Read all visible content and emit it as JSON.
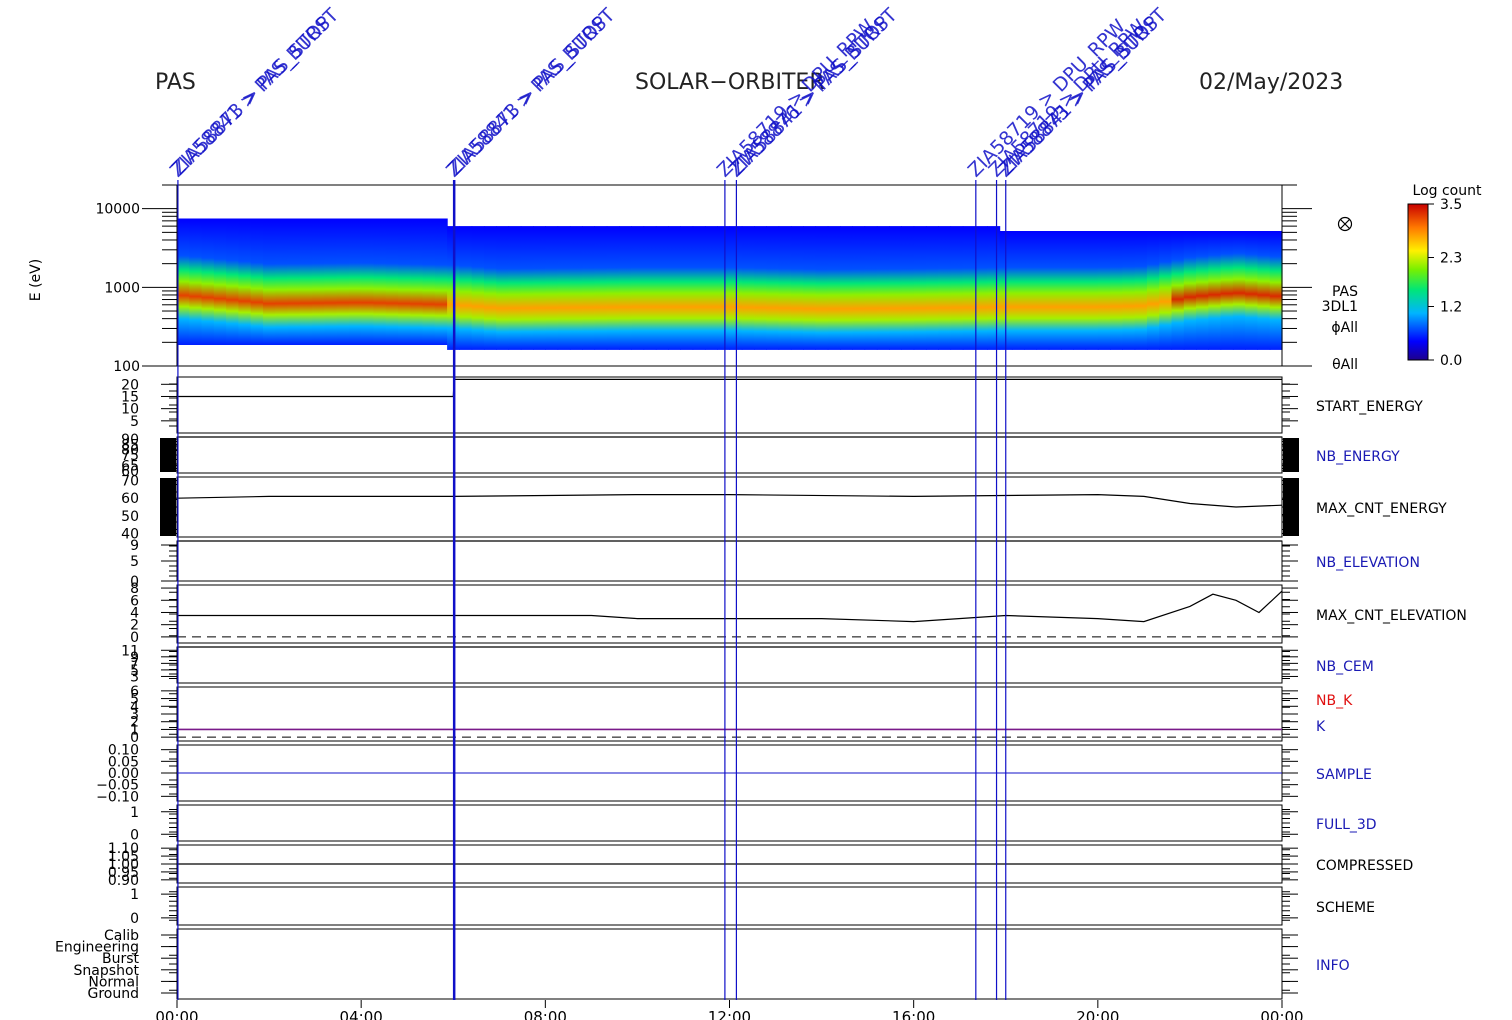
{
  "header": {
    "instrument": "PAS",
    "mission": "SOLAR−ORBITER",
    "date": "02/May/2023"
  },
  "colors": {
    "event_line": "#1010c8",
    "blue_label": "#1a1ab4",
    "red_label": "#e01010",
    "k_line": "#7a1a8a",
    "axes": "#000000"
  },
  "events": [
    {
      "t": 0.02,
      "labels": [
        "ZIA58841 > PAS_BURST",
        "ZIA58873 > PAS_STOP"
      ]
    },
    {
      "t": 6.02,
      "labels": [
        "ZIA58841 > PAS_BURST",
        "ZIA58873 > PAS_STOP"
      ]
    },
    {
      "t": 11.9,
      "labels": [
        "ZIA58719 > DPU_RPW"
      ]
    },
    {
      "t": 12.15,
      "labels": [
        "ZIA58876 > PAS_BURST",
        "ZIA58841 > PAS_STOP"
      ]
    },
    {
      "t": 17.35,
      "labels": [
        "ZIA58719 > DPU_RPW"
      ]
    },
    {
      "t": 17.8,
      "labels": [
        "ZIA58719 > DPU_RPW"
      ]
    },
    {
      "t": 18.0,
      "labels": [
        "ZIA58873 > PAS_BURST",
        "ZIA58841 > PAS_STOP"
      ]
    }
  ],
  "chart_data": {
    "type": "heatmap",
    "x_axis": {
      "range": [
        0,
        24
      ],
      "unit": "hours",
      "ticks": [
        "00:00",
        "04:00",
        "08:00",
        "12:00",
        "16:00",
        "20:00",
        "00:00"
      ]
    },
    "spectrogram": {
      "ylabel": "E (eV)",
      "ylim": [
        100,
        20000
      ],
      "log": true,
      "yticks": [
        "10000",
        "1000",
        "100"
      ],
      "right_labels": [
        "PAS",
        "3DL1",
        "ϕAll",
        "θAll"
      ],
      "colorbar": {
        "title": "Log count",
        "ticks": [
          "3.5",
          "2.3",
          "1.2",
          "0.0"
        ],
        "range": [
          0.0,
          3.5
        ]
      },
      "peak_energy_eV": [
        [
          0,
          800
        ],
        [
          2,
          620
        ],
        [
          4,
          640
        ],
        [
          6,
          600
        ],
        [
          7,
          540
        ],
        [
          10,
          560
        ],
        [
          12,
          560
        ],
        [
          14,
          530
        ],
        [
          16,
          540
        ],
        [
          18,
          560
        ],
        [
          20,
          560
        ],
        [
          21,
          580
        ],
        [
          22,
          750
        ],
        [
          23,
          850
        ],
        [
          24,
          760
        ]
      ]
    },
    "panels": [
      {
        "name": "START_ENERGY",
        "name_color": "black",
        "yticks": [
          "20",
          "15",
          "10",
          "5"
        ],
        "ylim": [
          0,
          23
        ],
        "series": [
          [
            0,
            15
          ],
          [
            6.0,
            15
          ],
          [
            6.02,
            22
          ],
          [
            24,
            22
          ]
        ]
      },
      {
        "name": "NB_ENERGY",
        "name_color": "blue",
        "yticks": [
          "90",
          "85",
          "80",
          "75",
          "65",
          "60"
        ],
        "ylim": [
          58,
          92
        ],
        "series": [
          [
            0,
            96
          ],
          [
            24,
            96
          ]
        ]
      },
      {
        "name": "MAX_CNT_ENERGY",
        "name_color": "black",
        "yticks": [
          "70",
          "60",
          "50",
          "40"
        ],
        "ylim": [
          38,
          72
        ],
        "series": [
          [
            0,
            60
          ],
          [
            2,
            61
          ],
          [
            6,
            61
          ],
          [
            10,
            62
          ],
          [
            12,
            62
          ],
          [
            16,
            61
          ],
          [
            20,
            62
          ],
          [
            21,
            61
          ],
          [
            22,
            57
          ],
          [
            23,
            55
          ],
          [
            24,
            56
          ]
        ]
      },
      {
        "name": "NB_ELEVATION",
        "name_color": "blue",
        "yticks": [
          "9",
          "5",
          "0"
        ],
        "ylim": [
          0,
          10
        ],
        "series": [
          [
            0,
            11
          ],
          [
            24,
            11
          ]
        ]
      },
      {
        "name": "MAX_CNT_ELEVATION",
        "name_color": "black",
        "yticks": [
          "8",
          "6",
          "4",
          "2",
          "0"
        ],
        "ylim": [
          -1,
          8.5
        ],
        "series": [
          [
            0,
            3.5
          ],
          [
            6,
            3.5
          ],
          [
            9,
            3.5
          ],
          [
            10,
            3
          ],
          [
            14,
            3
          ],
          [
            16,
            2.5
          ],
          [
            18,
            3.5
          ],
          [
            20,
            3
          ],
          [
            21,
            2.5
          ],
          [
            22,
            5
          ],
          [
            22.5,
            7
          ],
          [
            23,
            6
          ],
          [
            23.5,
            4
          ],
          [
            24,
            7.5
          ]
        ]
      },
      {
        "name": "NB_CEM",
        "name_color": "blue",
        "yticks": [
          "11",
          "9",
          "7",
          "5",
          "3"
        ],
        "ylim": [
          1,
          12
        ],
        "series": [
          [
            0,
            13
          ],
          [
            24,
            13
          ]
        ]
      },
      {
        "name": "NB_K",
        "name_color": "red",
        "yticks": [
          "6",
          "5",
          "4",
          "3",
          "2",
          "1",
          "0"
        ],
        "ylim": [
          -0.5,
          6.5
        ],
        "series": [
          [
            0,
            1
          ],
          [
            24,
            1
          ]
        ]
      },
      {
        "name": "SAMPLE",
        "name_color": "blue",
        "yticks": [
          "0.10",
          "0.05",
          "0.00",
          "−0.05",
          "−0.10"
        ],
        "ylim": [
          -0.12,
          0.12
        ],
        "series": []
      },
      {
        "name": "FULL_3D",
        "name_color": "blue",
        "yticks": [
          "1",
          "0"
        ],
        "ylim": [
          -0.3,
          1.3
        ],
        "series": []
      },
      {
        "name": "COMPRESSED",
        "name_color": "black",
        "yticks": [
          "1.10",
          "1.05",
          "1.00",
          "0.95",
          "0.90"
        ],
        "ylim": [
          0.88,
          1.12
        ],
        "series": [
          [
            0,
            1.0
          ],
          [
            24,
            1.0
          ]
        ]
      },
      {
        "name": "SCHEME",
        "name_color": "black",
        "yticks": [
          "1",
          "0"
        ],
        "ylim": [
          -0.3,
          1.3
        ],
        "series": []
      },
      {
        "name": "INFO",
        "name_color": "blue",
        "yticks": [
          "Calib",
          "Engineering",
          "Burst",
          "Snapshot",
          "Normal",
          "Ground"
        ],
        "ylim": [
          0,
          6
        ],
        "series": []
      }
    ],
    "k_label": "K"
  }
}
